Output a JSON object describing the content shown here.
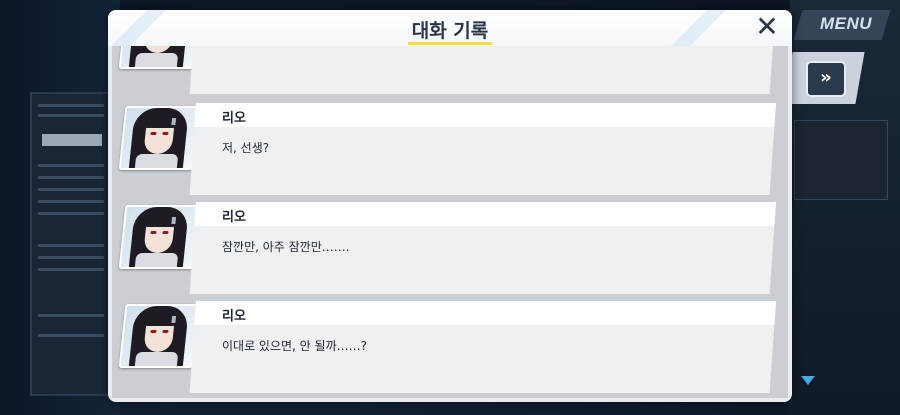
{
  "game_ui": {
    "menu_label": "MENU",
    "skip_icon": "fast-forward-icon",
    "scroll_indicator_icon": "triangle-down-icon"
  },
  "modal": {
    "title": "대화 기록",
    "close_icon": "close-x-icon",
    "accent_color": "#f2e038"
  },
  "dialog_log": [
    {
      "speaker": "",
      "text": ""
    },
    {
      "speaker": "리오",
      "text": "저, 선생?"
    },
    {
      "speaker": "리오",
      "text": "잠깐만, 아주 잠깐만……."
    },
    {
      "speaker": "리오",
      "text": "이대로 있으면, 안 될까……?"
    }
  ]
}
